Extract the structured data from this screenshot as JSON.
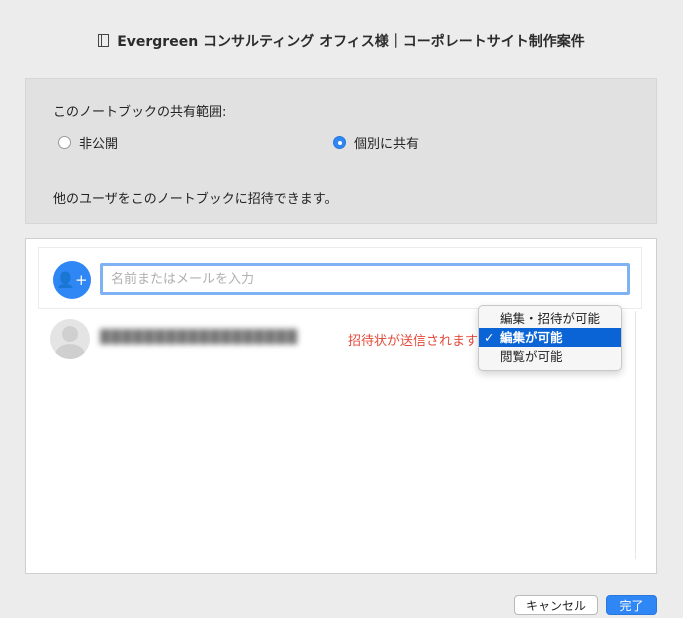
{
  "window": {
    "title": "Evergreen コンサルティング オフィス様｜コーポレートサイト制作案件",
    "icon": "notebook-icon"
  },
  "sharing": {
    "scope_label": "このノートブックの共有範囲:",
    "options": [
      {
        "label": "非公開",
        "checked": false
      },
      {
        "label": "個別に共有",
        "checked": true
      }
    ],
    "invite_description": "他のユーザをこのノートブックに招待できます。"
  },
  "invite": {
    "add_icon": "add-person-icon",
    "add_avatar_glyph": "👤+",
    "input_placeholder": "名前またはメールを入力",
    "input_value": ""
  },
  "people": [
    {
      "name": "██████████████████",
      "status": "招待状が送信されます",
      "avatar": "person-placeholder-icon"
    }
  ],
  "permission_menu": {
    "check_glyph": "✓",
    "items": [
      {
        "label": "編集・招待が可能",
        "selected": false
      },
      {
        "label": "編集が可能",
        "selected": true
      },
      {
        "label": "閲覧が可能",
        "selected": false
      }
    ]
  },
  "buttons": {
    "cancel": "キャンセル",
    "done": "完了"
  },
  "colors": {
    "accent": "#2f86f5",
    "status_text": "#e24b3b",
    "menu_highlight": "#0a64d6"
  }
}
